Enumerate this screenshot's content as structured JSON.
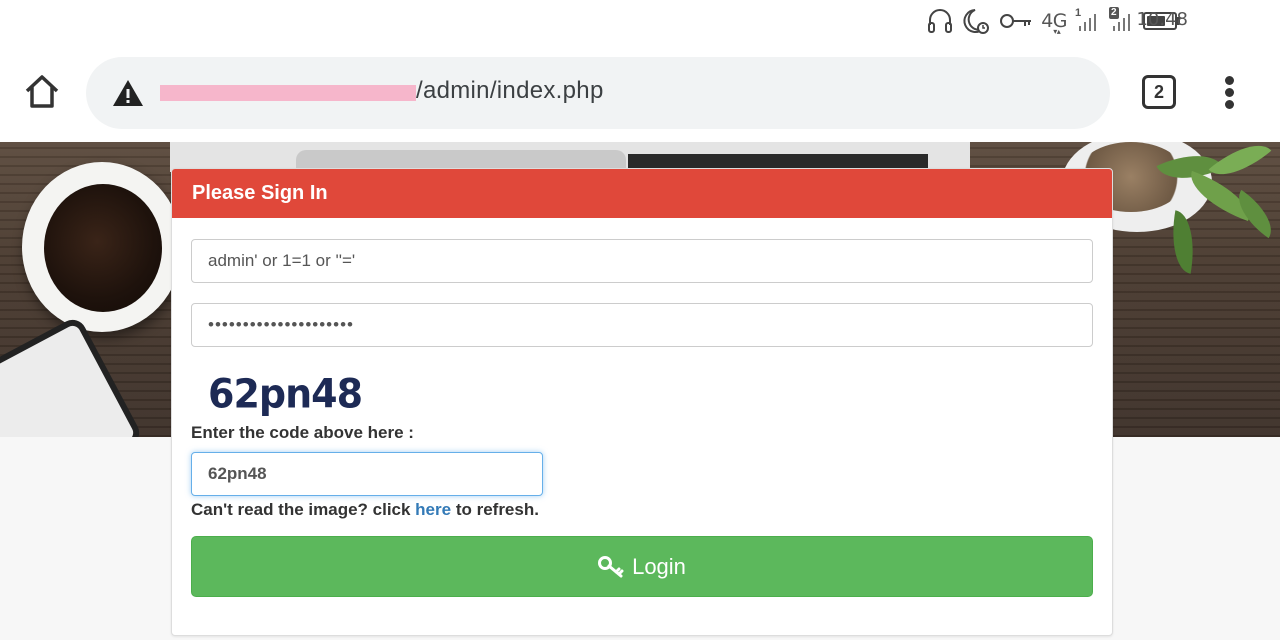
{
  "status_bar": {
    "network_label": "4G",
    "sim1_badge": "1",
    "sim2_badge": "2",
    "battery_level": 0.7,
    "time": "10.48"
  },
  "browser": {
    "url_path": "/admin/index.php",
    "tab_count": "2",
    "url_redacted_color": "#f6b6cb"
  },
  "login": {
    "heading": "Please Sign In",
    "heading_color": "#e0483a",
    "username_value": "admin' or 1=1 or ''='",
    "password_value": "•••••••••••••••••••••",
    "captcha_image_text": "62pn48",
    "code_label": "Enter the code above here :",
    "code_value": "62pn48",
    "refresh_prefix": "Can't read the image? click ",
    "refresh_link": "here",
    "refresh_suffix": " to refresh.",
    "login_label": "Login",
    "login_color": "#5cb85c",
    "login_icon": "key-icon"
  }
}
